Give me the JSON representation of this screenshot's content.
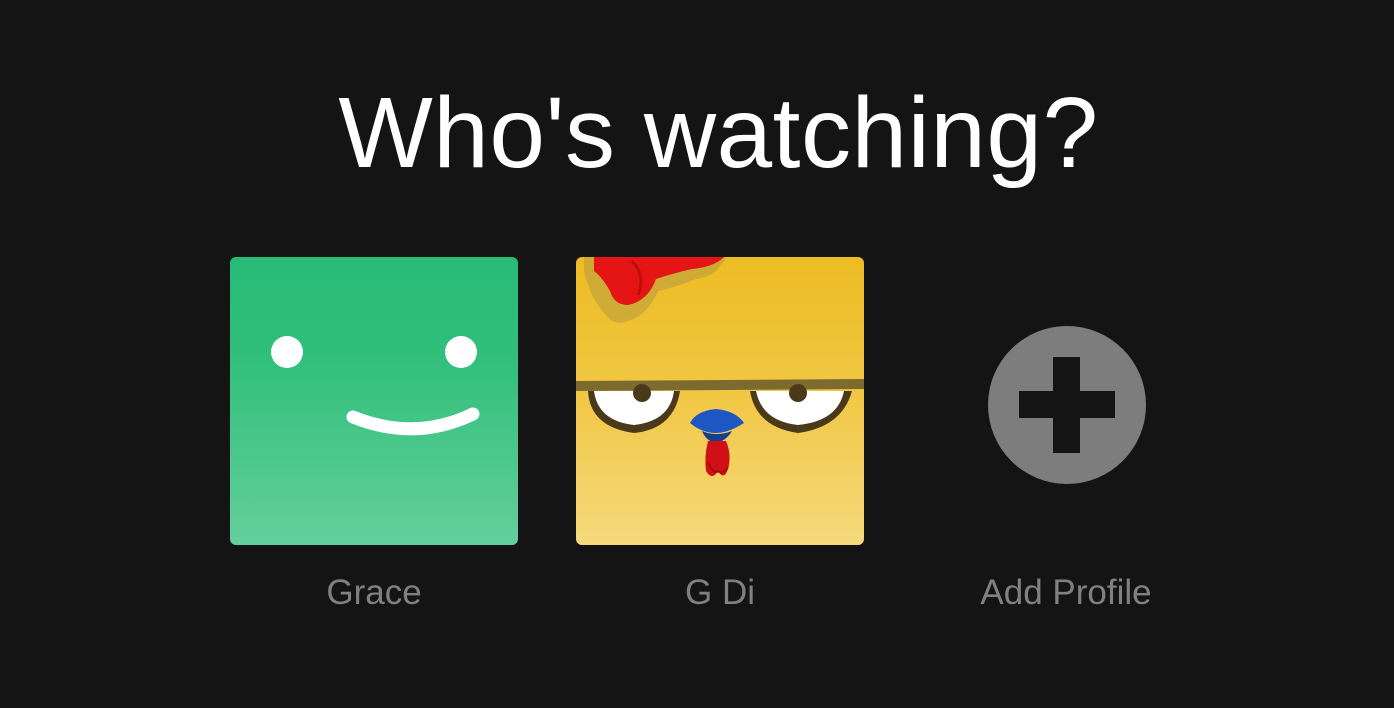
{
  "heading": "Who's watching?",
  "profiles": [
    {
      "name": "Grace",
      "avatar_icon": "smiley-face-icon",
      "avatar_color": "#2bbd7e"
    },
    {
      "name": "G Di",
      "avatar_icon": "chicken-face-icon",
      "avatar_color": "#f0c73a"
    }
  ],
  "add_profile": {
    "label": "Add Profile",
    "icon": "plus-circle-icon",
    "color": "#7d7d7d"
  },
  "colors": {
    "background": "#141414",
    "heading": "#ffffff",
    "profile_name": "#808080"
  }
}
